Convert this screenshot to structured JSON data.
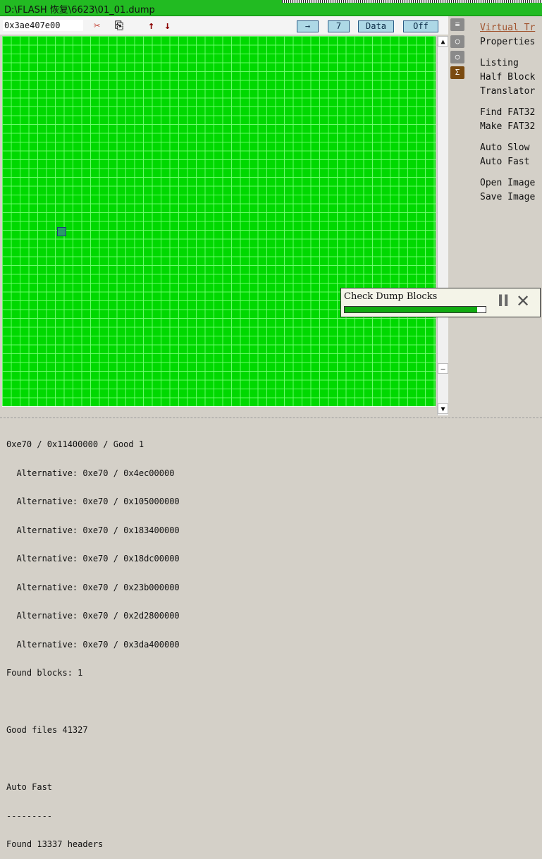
{
  "window": {
    "title": "D:\\FLASH 恢复\\6623\\01_01.dump"
  },
  "toolbar": {
    "address": "0x3ae407e00",
    "icons": [
      "cut-icon",
      "copy-icon",
      "arrow-up-icon",
      "arrow-down-icon"
    ],
    "arrow_label": "→",
    "num_label": "7",
    "data_label": "Data",
    "off_label": "Off"
  },
  "scrollbar": {
    "up": "▲",
    "mid": "–",
    "down": "▼"
  },
  "side_icons": [
    "list-icon",
    "bulb-icon",
    "bulb-icon",
    "translator-icon"
  ],
  "menu": {
    "virtual": "Virtual Tr",
    "properties": "Properties",
    "listing": "Listing",
    "half_block": "Half Block",
    "translator": "Translator",
    "find_fat32": "Find FAT32",
    "make_fat32": "Make FAT32",
    "auto_slow": "Auto Slow",
    "auto_fast": "Auto Fast",
    "open_image": "Open Image",
    "save_image": "Save Image"
  },
  "popup": {
    "title": "Check Dump Blocks",
    "progress": 0.94,
    "pause": "II",
    "close": "✕"
  },
  "log": {
    "lines": [
      "0xe70 / 0x11400000 / Good 1",
      "  Alternative: 0xe70 / 0x4ec00000",
      "  Alternative: 0xe70 / 0x105000000",
      "  Alternative: 0xe70 / 0x183400000",
      "  Alternative: 0xe70 / 0x18dc00000",
      "  Alternative: 0xe70 / 0x23b000000",
      "  Alternative: 0xe70 / 0x2d2800000",
      "  Alternative: 0xe70 / 0x3da400000",
      "Found blocks: 1",
      "",
      "Good files 41327",
      "",
      "Auto Fast",
      "---------",
      "Found 13337 headers"
    ]
  },
  "colors": {
    "grid": "#00cc00",
    "title": "#22bb22",
    "button": "#add8e6"
  }
}
